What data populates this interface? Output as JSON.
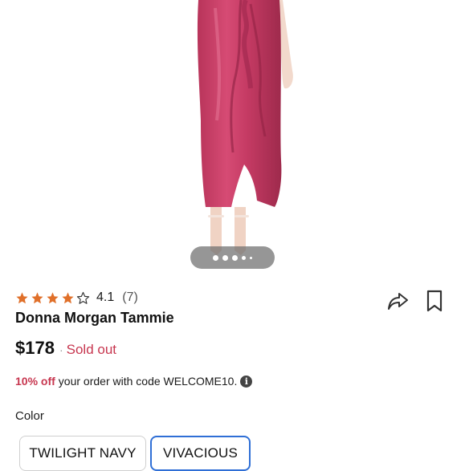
{
  "carousel": {
    "image_alt": "Model wearing pink satin wrap midi skirt",
    "dot_count": 5,
    "active_index": 0
  },
  "product": {
    "rating_value": "4.1",
    "rating_count": "(7)",
    "stars_filled": 4,
    "stars_total": 5,
    "title": "Donna Morgan Tammie",
    "price": "$178",
    "separator": "·",
    "status": "Sold out"
  },
  "promo": {
    "discount": "10% off",
    "text": "your order with code WELCOME10."
  },
  "options": {
    "color_label": "Color",
    "colors": [
      "TWILIGHT NAVY",
      "VIVACIOUS"
    ],
    "selected": "VIVACIOUS"
  },
  "icons": {
    "share": "share-arrow-icon",
    "bookmark": "bookmark-icon",
    "info": "info-icon",
    "star": "star-icon"
  },
  "colors": {
    "accent_red": "#c7364f",
    "star_orange": "#e0702a",
    "selected_border": "#2f6fd6"
  }
}
